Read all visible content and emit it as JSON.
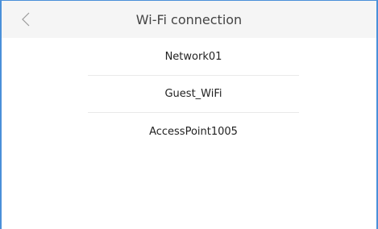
{
  "header": {
    "title": "Wi-Fi connection",
    "back_icon": "chevron-left-icon"
  },
  "networks": [
    {
      "name": "Network01"
    },
    {
      "name": "Guest_WiFi"
    },
    {
      "name": "AccessPoint1005"
    }
  ],
  "colors": {
    "frame_border": "#4a90d9",
    "header_bg": "#f5f5f5"
  }
}
